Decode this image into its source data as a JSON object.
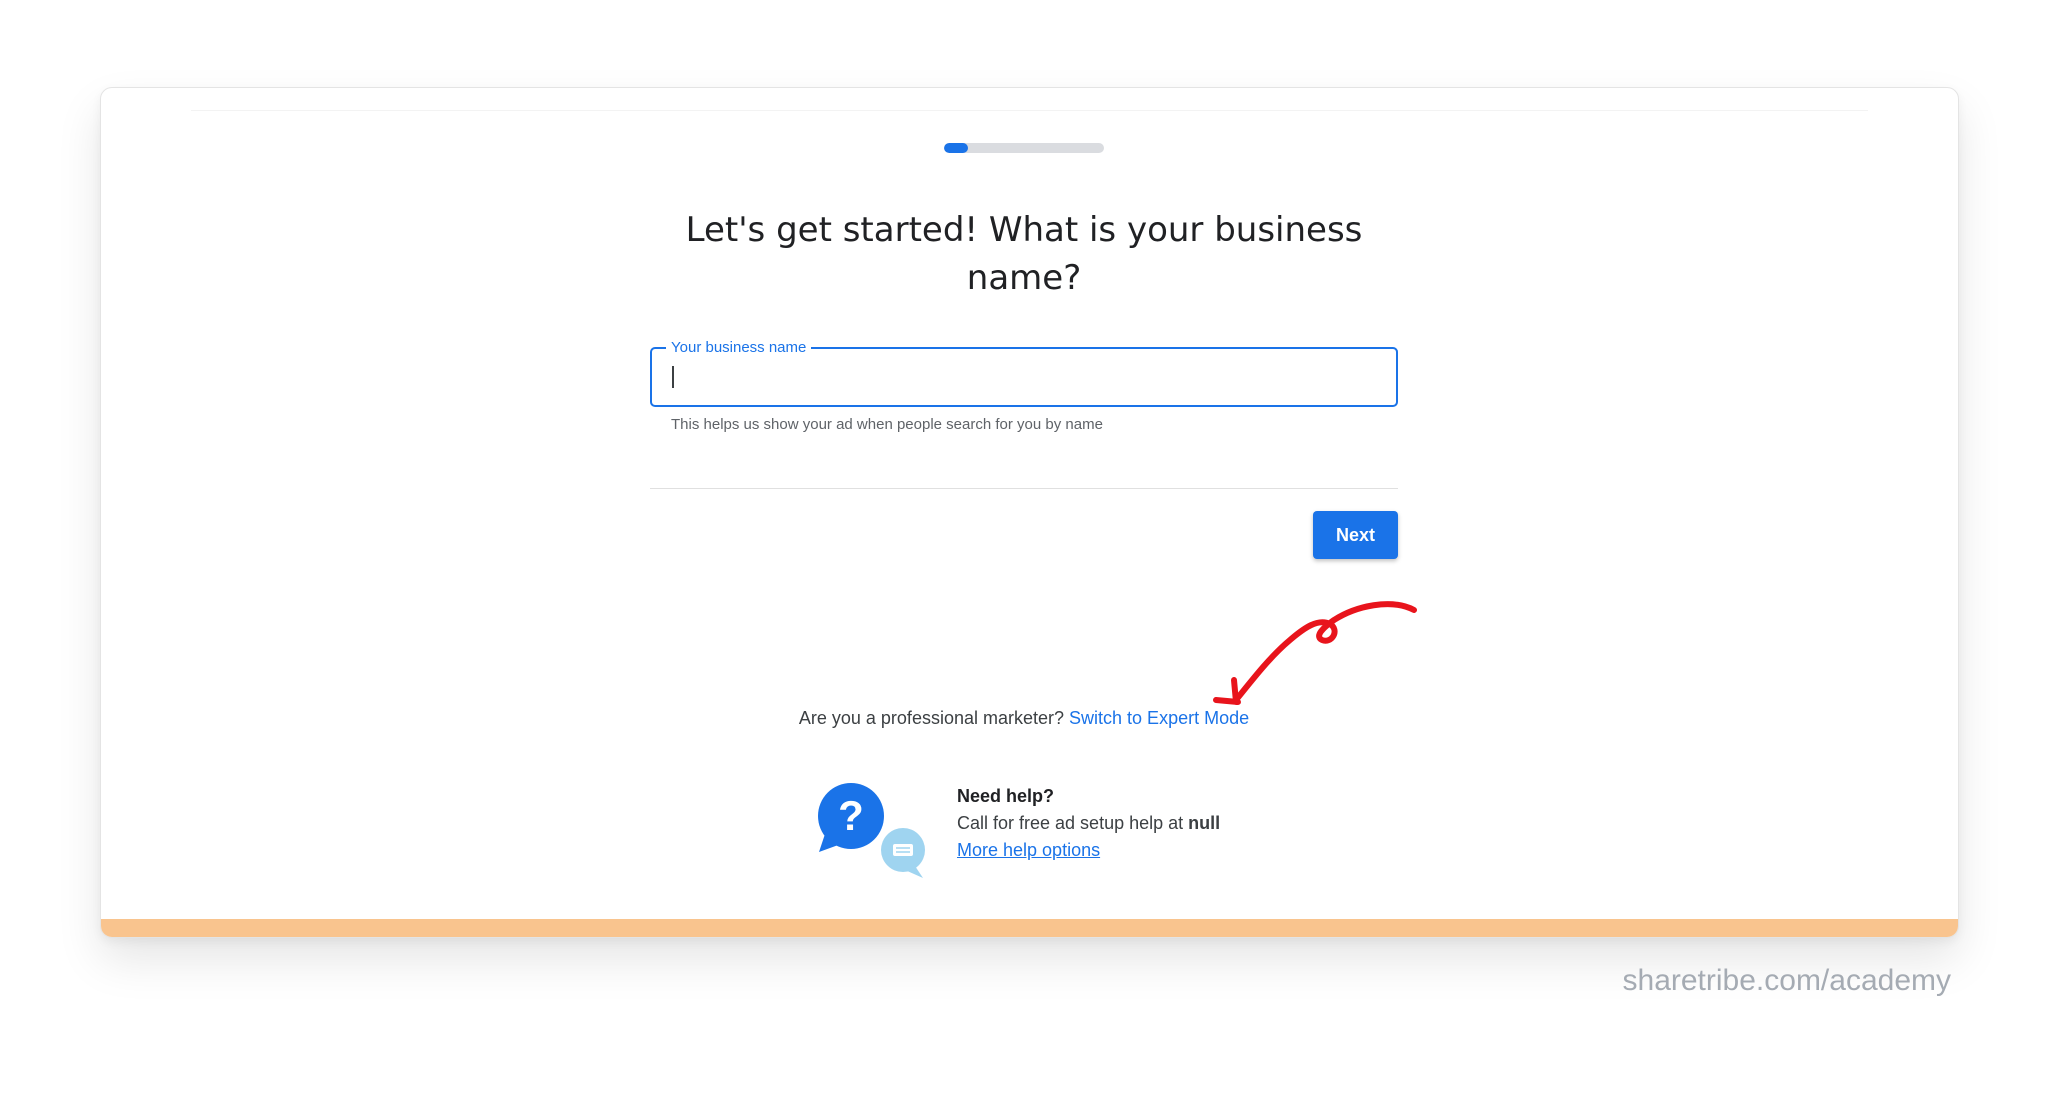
{
  "progress": {
    "fraction": 0.15,
    "color": "#1a73e8",
    "track_color": "#dadce0"
  },
  "page": {
    "title": "Let's get started! What is your business name?"
  },
  "business_field": {
    "label": "Your business name",
    "value": "",
    "helper": "This helps us show your ad when people search for you by name"
  },
  "actions": {
    "next_label": "Next"
  },
  "expert": {
    "prompt": "Are you a professional marketer?",
    "link_label": "Switch to Expert Mode",
    "annotation_color": "#e8141c"
  },
  "help": {
    "icon": "help-chat-bubbles-icon",
    "title": "Need help?",
    "call_text": "Call for free ad setup help at",
    "phone": "null",
    "more_link": "More help options"
  },
  "watermark": {
    "text": "sharetribe.com/academy"
  },
  "colors": {
    "accent_bar": "#f9c48e",
    "primary": "#1a73e8"
  }
}
